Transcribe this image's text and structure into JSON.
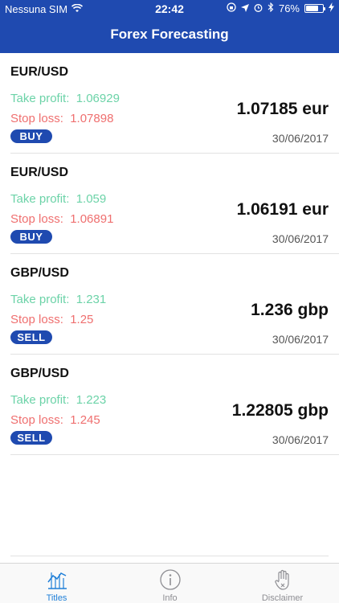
{
  "status_bar": {
    "carrier": "Nessuna SIM",
    "time": "22:42",
    "battery_percent": "76%",
    "battery_level": 0.76,
    "icons": [
      "wifi-icon",
      "lock-rotation-icon",
      "location-arrow-icon",
      "alarm-icon",
      "bluetooth-icon",
      "battery-icon",
      "charging-icon"
    ]
  },
  "nav": {
    "title": "Forex Forecasting"
  },
  "rows": [
    {
      "pair": "EUR/USD",
      "take_profit": "Take profit:  1.06929",
      "stop_loss": "Stop loss:  1.07898",
      "action": "BUY",
      "price": "1.07185 eur",
      "date": "30/06/2017"
    },
    {
      "pair": "EUR/USD",
      "take_profit": "Take profit:  1.059",
      "stop_loss": "Stop loss:  1.06891",
      "action": "BUY",
      "price": "1.06191 eur",
      "date": "30/06/2017"
    },
    {
      "pair": "GBP/USD",
      "take_profit": "Take profit:  1.231",
      "stop_loss": "Stop loss:  1.25",
      "action": "SELL",
      "price": "1.236 gbp",
      "date": "30/06/2017"
    },
    {
      "pair": "GBP/USD",
      "take_profit": "Take profit:  1.223",
      "stop_loss": "Stop loss:  1.245",
      "action": "SELL",
      "price": "1.22805 gbp",
      "date": "30/06/2017"
    }
  ],
  "tabs": [
    {
      "label": "Titles",
      "icon": "chart-icon",
      "active": true
    },
    {
      "label": "Info",
      "icon": "info-icon",
      "active": false
    },
    {
      "label": "Disclaimer",
      "icon": "hand-icon",
      "active": false
    }
  ],
  "colors": {
    "brand": "#1f4ab0",
    "take_profit": "#6cd3a8",
    "stop_loss": "#ef6f6f",
    "active_tab": "#1f7fd8",
    "inactive_tab": "#8e8e93"
  }
}
